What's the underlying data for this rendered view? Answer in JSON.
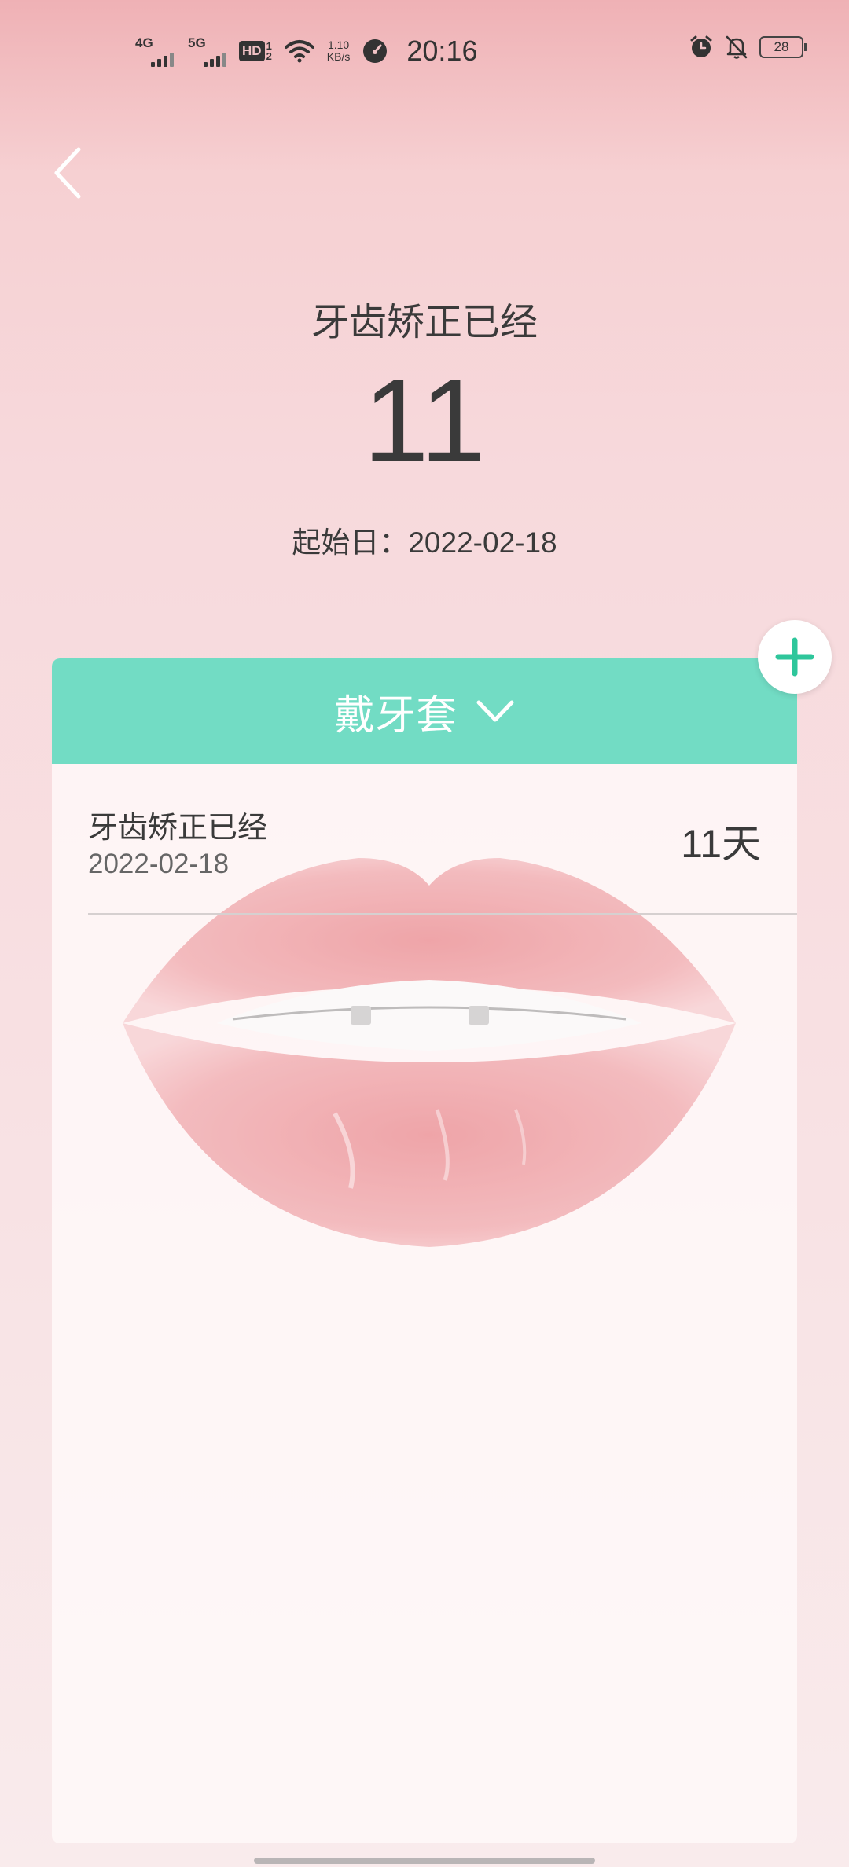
{
  "status_bar": {
    "net1": "4G",
    "net2": "5G",
    "hd_label": "HD",
    "hd_sub_top": "1",
    "hd_sub_bottom": "2",
    "speed_value": "1.10",
    "speed_unit": "KB/s",
    "time": "20:16",
    "battery": "28"
  },
  "header": {
    "title": "牙齿矫正已经",
    "count": "11",
    "start_date": "起始日：2022-02-18"
  },
  "card": {
    "header_label": "戴牙套",
    "accent_color": "#72dcc4",
    "items": [
      {
        "title": "牙齿矫正已经",
        "date": "2022-02-18",
        "days": "11天"
      }
    ]
  }
}
